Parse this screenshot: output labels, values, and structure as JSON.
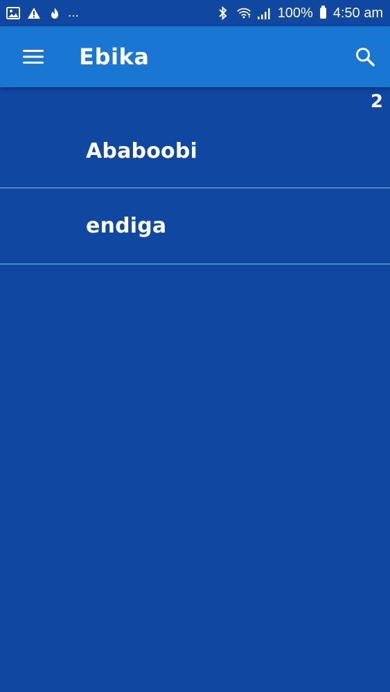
{
  "status_bar": {
    "icons_left": [
      "image-icon",
      "warning-icon",
      "flame-icon"
    ],
    "overflow": "...",
    "icons_right": [
      "bluetooth-icon",
      "wifi-icon",
      "signal-icon"
    ],
    "battery": "100%",
    "time": "4:50 am"
  },
  "app_bar": {
    "title": "Ebika",
    "menu_icon": "menu-icon",
    "search_icon": "search-icon"
  },
  "content": {
    "count": "2",
    "items": [
      {
        "label": "Ababoobi"
      },
      {
        "label": "endiga"
      }
    ]
  },
  "colors": {
    "background": "#0f47a1",
    "app_bar": "#1976d2",
    "text": "#ffffff",
    "divider": "#9fb6e6"
  }
}
